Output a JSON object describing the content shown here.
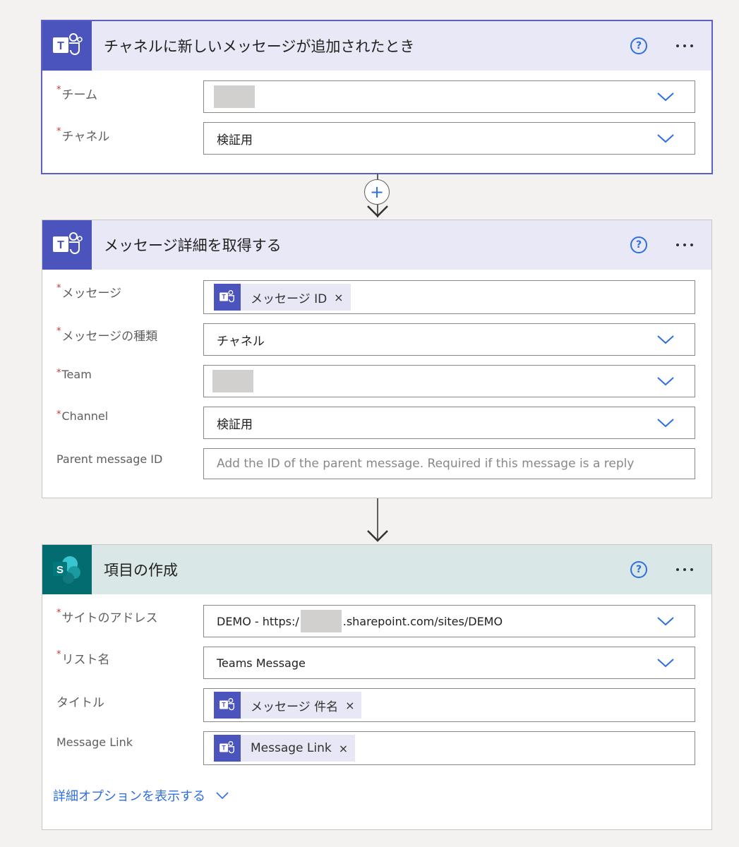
{
  "trigger": {
    "title": "チャネルに新しいメッセージが追加されたとき",
    "fields": {
      "team_label": "チーム",
      "channel_label": "チャネル",
      "channel_value": "検証用"
    }
  },
  "action1": {
    "title": "メッセージ詳細を取得する",
    "fields": {
      "message_label": "メッセージ",
      "message_token": "メッセージ ID",
      "type_label": "メッセージの種類",
      "type_value": "チャネル",
      "team_label": "Team",
      "channel_label": "Channel",
      "channel_value": "検証用",
      "parent_label": "Parent message ID",
      "parent_placeholder": "Add the ID of the parent message. Required if this message is a reply"
    }
  },
  "action2": {
    "title": "項目の作成",
    "fields": {
      "site_label": "サイトのアドレス",
      "site_prefix": "DEMO - https:/",
      "site_suffix": ".sharepoint.com/sites/DEMO",
      "list_label": "リスト名",
      "list_value": "Teams Message",
      "title_label": "タイトル",
      "title_token": "メッセージ 件名",
      "link_label": "Message Link",
      "link_token": "Message Link"
    },
    "advanced_link": "詳細オプションを表示する"
  },
  "common": {
    "required_mark": "*",
    "help_glyph": "?",
    "close_glyph": "×",
    "plus_glyph": "+",
    "sp_letter": "S"
  },
  "colors": {
    "teams": "#4b53bc",
    "sharepoint": "#036c70",
    "link": "#2e6fe0",
    "required": "#d13438"
  }
}
